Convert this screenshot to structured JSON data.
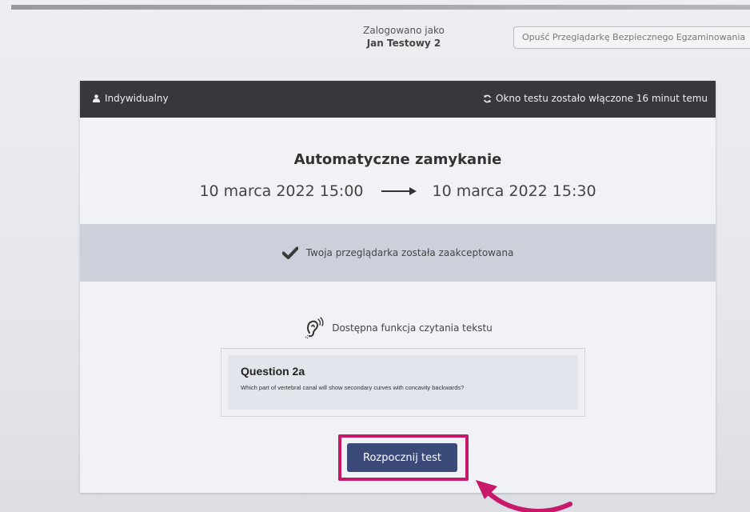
{
  "topbar": {
    "logged_in_label": "Zalogowano jako",
    "user_name": "Jan Testowy 2",
    "exit_button_label": "Opuść Przeglądarkę Bezpiecznego Egzaminowania"
  },
  "card": {
    "header": {
      "mode_label": "Indywidualny",
      "window_status": "Okno testu zostało włączone 16 minut temu"
    },
    "title": "Automatyczne zamykanie",
    "start_date": "10 marca 2022 15:00",
    "end_date": "10 marca 2022 15:30",
    "browser_status": "Twoja przeglądarka została zaakceptowana",
    "text_reader_label": "Dostępna funkcja czytania tekstu",
    "question_preview": {
      "title": "Question 2a",
      "text": "Which part of vertebral canal will show secondary curves with concavity backwards?"
    },
    "start_button_label": "Rozpocznij test"
  },
  "colors": {
    "header_bg": "#37383d",
    "button_bg": "#3b4a78",
    "highlight": "#c8186a",
    "status_band": "#ccd0da"
  },
  "icons": [
    "user-icon",
    "refresh-icon",
    "checkmark-icon",
    "text-reader-icon",
    "arrow-right-icon",
    "curved-pointer-arrow"
  ]
}
